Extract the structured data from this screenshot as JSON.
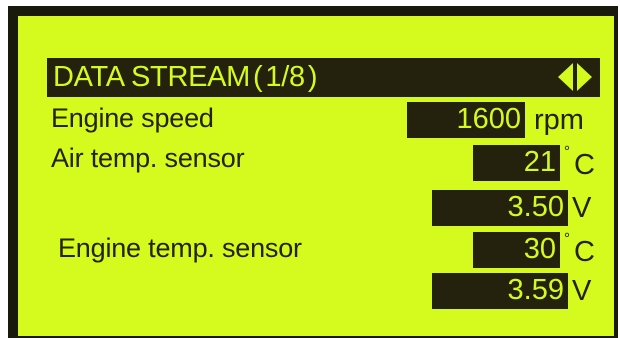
{
  "colors": {
    "lcd_background": "#d4fb1d",
    "lcd_foreground": "#24210d",
    "bezel": "#191a0c"
  },
  "header": {
    "title": "DATA STREAM",
    "page_indicator": "1/8",
    "open_paren": "(",
    "close_paren": ")",
    "nav_icons": [
      "arrow-left-icon",
      "arrow-right-icon"
    ]
  },
  "rows": [
    {
      "label": "Engine speed",
      "value": "1600",
      "unit": "rpm"
    },
    {
      "label": "Air temp. sensor",
      "value": "21",
      "degree": "°",
      "unit": "C"
    },
    {
      "label": "",
      "value": "3.50",
      "unit": "V"
    },
    {
      "label": "Engine temp. sensor",
      "value": "30",
      "degree": "°",
      "unit": "C"
    },
    {
      "label": "",
      "value": "3.59",
      "unit": "V"
    }
  ]
}
